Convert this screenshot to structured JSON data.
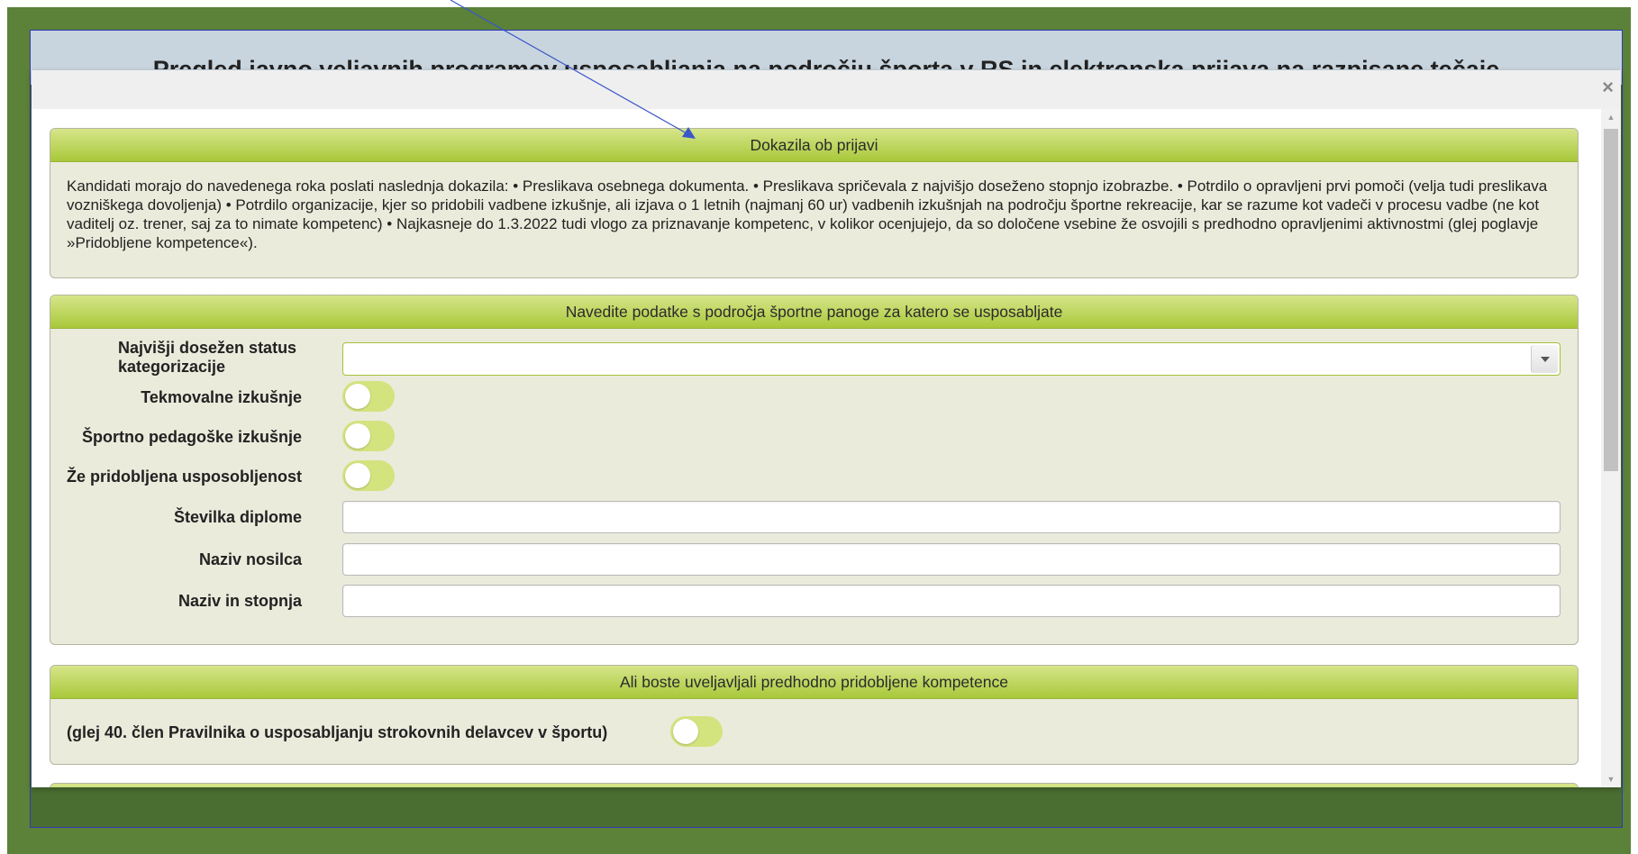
{
  "background": {
    "title": "Pregled javno veljavnih programov usposabljanja na področju športa v RS in elektronska prijava na razpisane tečaje"
  },
  "modal": {
    "close_symbol": "×",
    "panels": {
      "documents": {
        "header": "Dokazila ob prijavi",
        "body": "Kandidati morajo do navedenega roka poslati naslednja dokazila: • Preslikava osebnega dokumenta. • Preslikava spričevala z najvišjo doseženo stopnjo izobrazbe. • Potrdilo o opravljeni prvi pomoči (velja tudi preslikava vozniškega dovoljenja) • Potrdilo organizacije, kjer so pridobili vadbene izkušnje, ali izjava o 1 letnih (najmanj 60 ur) vadbenih izkušnjah na področju športne rekreacije, kar se razume kot vadeči v procesu vadbe (ne kot vaditelj oz. trener, saj za to nimate kompetenc) • Najkasneje do 1.3.2022 tudi vlogo za priznavanje kompetenc, v kolikor ocenjujejo, da so določene vsebine že osvojili s predhodno opravljenimi aktivnostmi (glej poglavje »Pridobljene kompetence«)."
      },
      "sport": {
        "header": "Navedite podatke s področja športne panoge za katero se usposabljate",
        "fields": {
          "status_label": "Najvišji dosežen status kategorizacije",
          "status_value": "",
          "competitive_label": "Tekmovalne izkušnje",
          "pedagogical_label": "Športno pedagoške izkušnje",
          "qualification_label": "Že pridobljena usposobljenost",
          "diploma_label": "Številka diplome",
          "diploma_value": "",
          "holder_label": "Naziv nosilca",
          "holder_value": "",
          "title_label": "Naziv in stopnja",
          "title_value": ""
        },
        "toggles": {
          "competitive": false,
          "pedagogical": false,
          "qualification": false
        }
      },
      "competences": {
        "header": "Ali boste uveljavljali predhodno pridobljene kompetence",
        "label": "(glej 40. člen Pravilnika o usposabljanju strokovnih delavcev v športu)",
        "toggle": false
      }
    }
  },
  "colors": {
    "page_green": "#5b8238",
    "panel_header": "#a9c83a",
    "toggle_off": "#d3e37e",
    "annotation_arrow": "#3a56c9"
  }
}
